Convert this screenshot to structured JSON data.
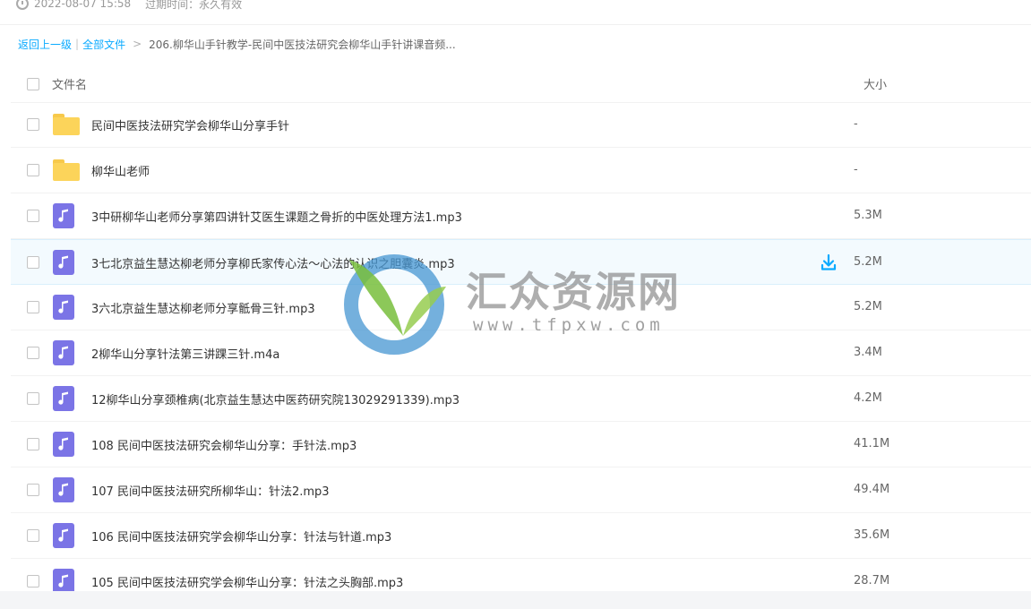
{
  "meta": {
    "created": "2022-08-07 15:58",
    "expiry": "过期时间：永久有效"
  },
  "breadcrumb": {
    "back": "返回上一级",
    "separator": "|",
    "all_files": "全部文件",
    "arrow": ">",
    "current": "206.柳华山手针教学-民间中医技法研究会柳华山手针讲课音频..."
  },
  "table": {
    "col_name": "文件名",
    "col_size": "大小"
  },
  "files": [
    {
      "type": "folder",
      "name": "民间中医技法研究学会柳华山分享手针",
      "size": "-"
    },
    {
      "type": "folder",
      "name": "柳华山老师",
      "size": "-"
    },
    {
      "type": "audio",
      "name": "3中研柳华山老师分享第四讲针艾医生课题之骨折的中医处理方法1.mp3",
      "size": "5.3M"
    },
    {
      "type": "audio",
      "name": "3七北京益生慧达柳老师分享柳氏家传心法～心法的认识之胆囊炎.mp3",
      "size": "5.2M"
    },
    {
      "type": "audio",
      "name": "3六北京益生慧达柳老师分享骶骨三针.mp3",
      "size": "5.2M"
    },
    {
      "type": "audio",
      "name": "2柳华山分享针法第三讲踝三针.m4a",
      "size": "3.4M"
    },
    {
      "type": "audio",
      "name": "12柳华山分享颈椎病(北京益生慧达中医药研究院13029291339).mp3",
      "size": "4.2M"
    },
    {
      "type": "audio",
      "name": "108 民间中医技法研究会柳华山分享：手针法.mp3",
      "size": "41.1M"
    },
    {
      "type": "audio",
      "name": "107 民间中医技法研究所柳华山：针法2.mp3",
      "size": "49.4M"
    },
    {
      "type": "audio",
      "name": "106 民间中医技法研究学会柳华山分享：针法与针道.mp3",
      "size": "35.6M"
    },
    {
      "type": "audio",
      "name": "105 民间中医技法研究学会柳华山分享：针法之头胸部.mp3",
      "size": "28.7M"
    }
  ],
  "watermark": {
    "title": "汇众资源网",
    "url": "www.tfpxw.com"
  },
  "colors": {
    "link": "#09aaff",
    "folder": "#fcd45a",
    "audio_icon": "#7b74e6",
    "hover_row": "#f3fafe"
  }
}
